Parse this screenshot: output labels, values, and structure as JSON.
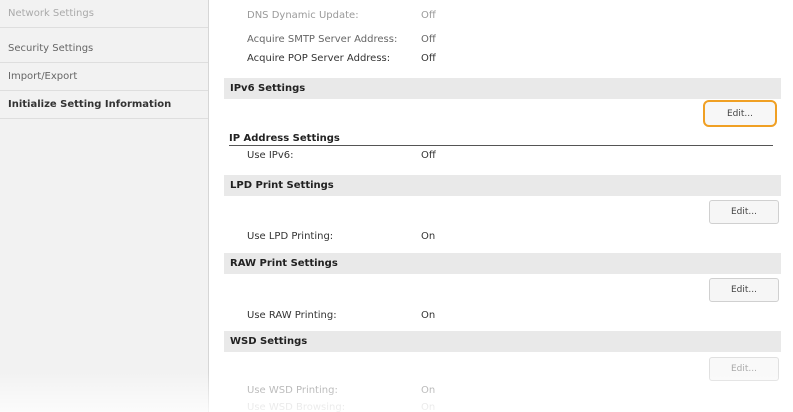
{
  "sidebar": {
    "items": [
      {
        "label": "Network Settings"
      },
      {
        "label": "Security Settings"
      },
      {
        "label": "Import/Export"
      },
      {
        "label": "Initialize Setting Information"
      }
    ]
  },
  "top_rows": [
    {
      "label": "DNS Dynamic Update:",
      "value": "Off"
    },
    {
      "label": "Acquire SMTP Server Address:",
      "value": "Off"
    },
    {
      "label": "Acquire POP Server Address:",
      "value": "Off"
    }
  ],
  "ipv6": {
    "title": "IPv6 Settings",
    "edit_label": "Edit...",
    "subsection": "IP Address Settings",
    "rows": [
      {
        "label": "Use IPv6:",
        "value": "Off"
      }
    ]
  },
  "lpd": {
    "title": "LPD Print Settings",
    "edit_label": "Edit...",
    "rows": [
      {
        "label": "Use LPD Printing:",
        "value": "On"
      }
    ]
  },
  "raw": {
    "title": "RAW Print Settings",
    "edit_label": "Edit...",
    "rows": [
      {
        "label": "Use RAW Printing:",
        "value": "On"
      }
    ]
  },
  "wsd": {
    "title": "WSD Settings",
    "edit_label": "Edit...",
    "rows": [
      {
        "label": "Use WSD Printing:",
        "value": "On"
      },
      {
        "label": "Use WSD Browsing:",
        "value": "On"
      }
    ]
  },
  "colors": {
    "focus_outline": "#f0a024",
    "section_bg": "#e9e9e9",
    "sidebar_bg": "#f2f2f2"
  }
}
